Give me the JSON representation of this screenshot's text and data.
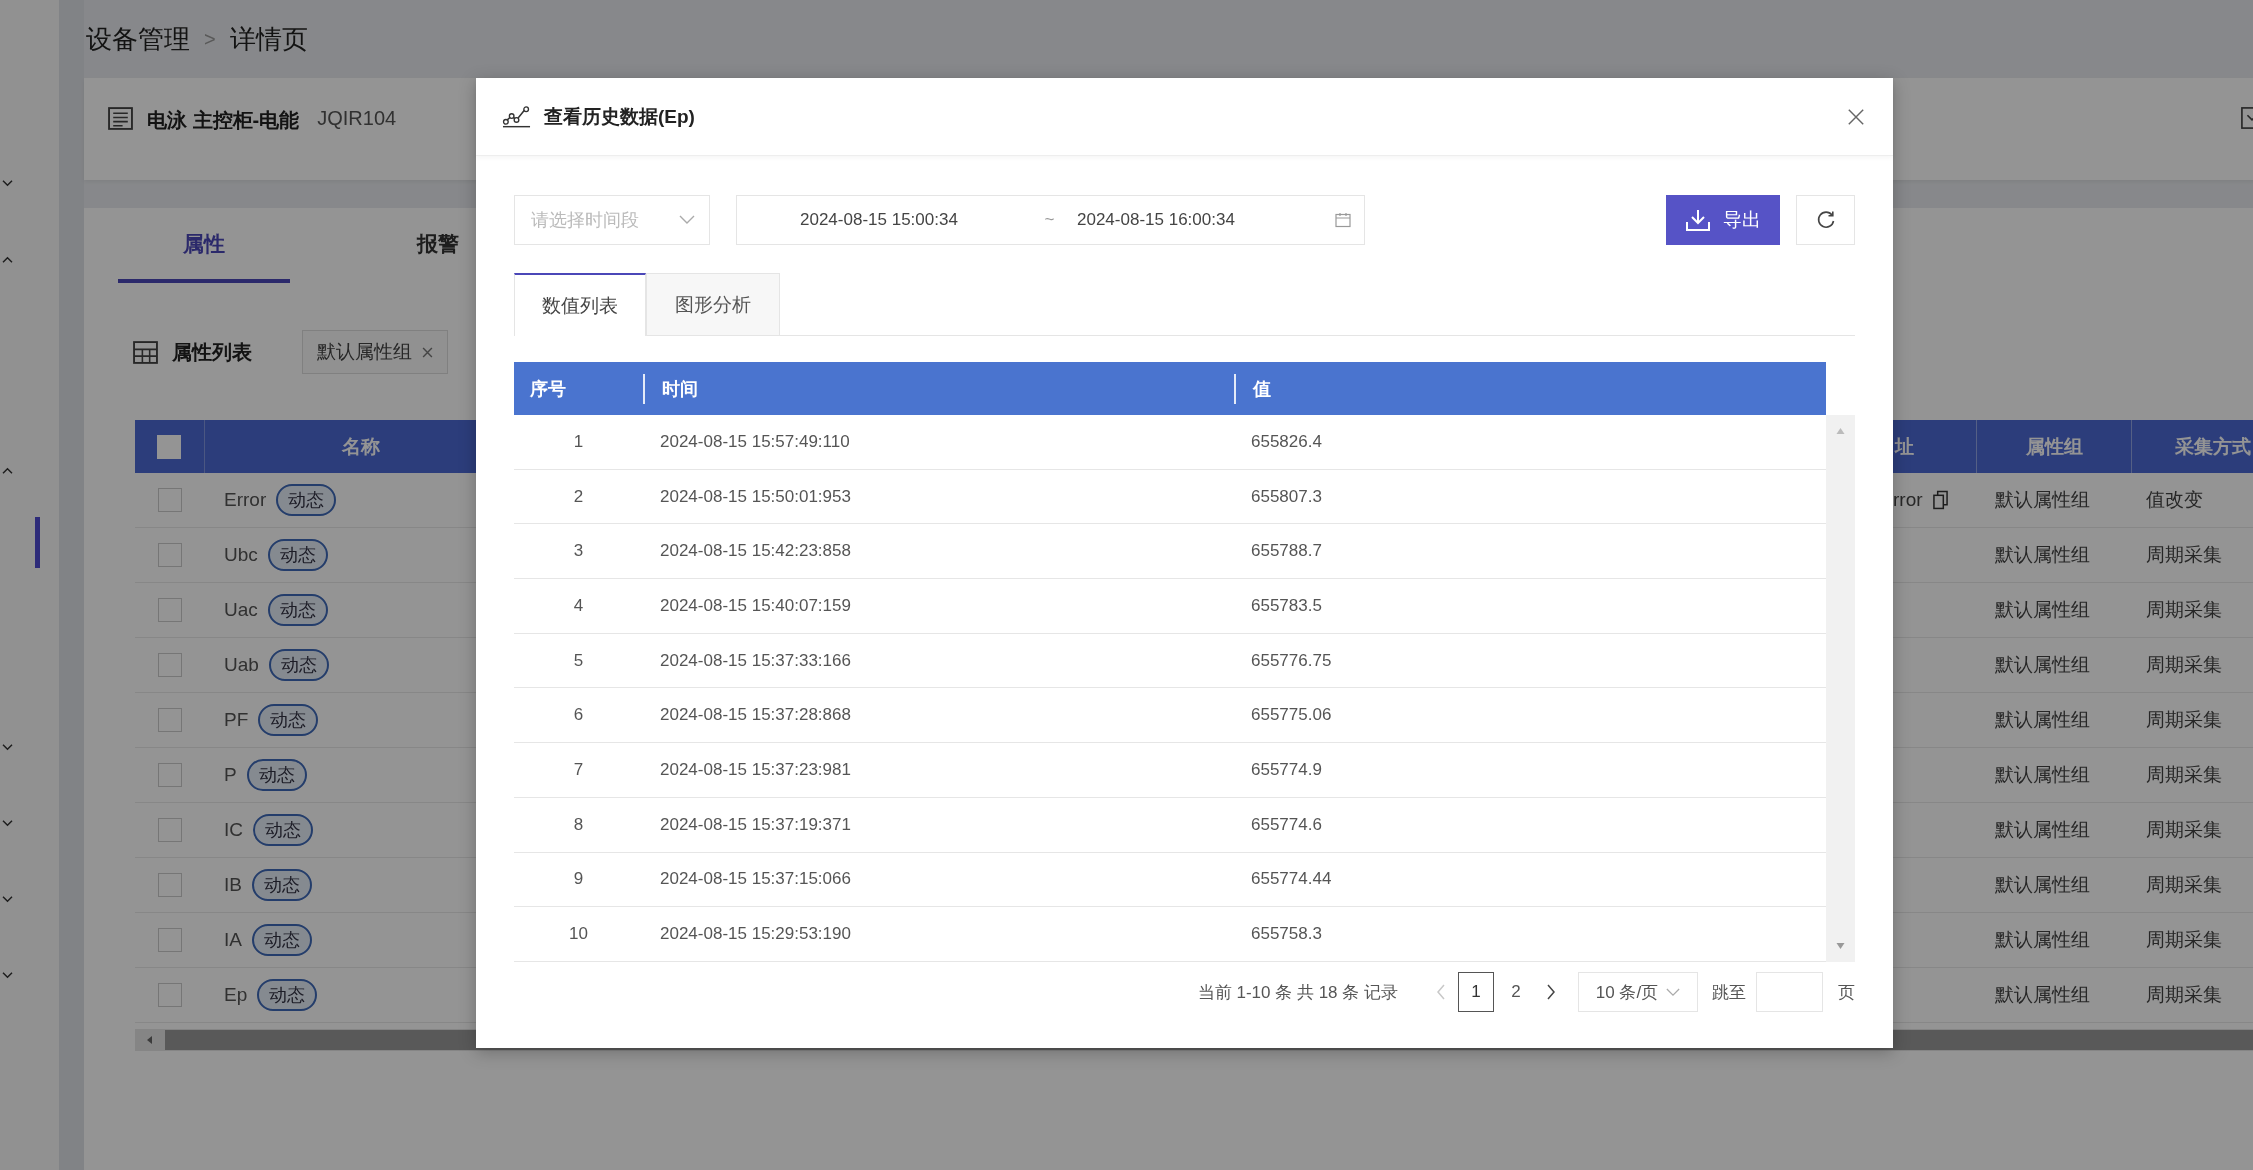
{
  "breadcrumb": {
    "items": [
      "设备管理",
      "详情页"
    ],
    "separator": ">"
  },
  "sidebar": {
    "items": [
      {
        "kind": "group",
        "expanded": false
      },
      {
        "kind": "group",
        "expanded": true
      },
      {
        "kind": "group",
        "expanded": true
      },
      {
        "kind": "link",
        "selected": true
      },
      {
        "kind": "group",
        "expanded": false
      },
      {
        "kind": "group",
        "expanded": false
      },
      {
        "kind": "group",
        "expanded": false
      },
      {
        "kind": "group",
        "expanded": false
      }
    ]
  },
  "device": {
    "name": "电泳 主控柜-电能",
    "code": "JQIR104"
  },
  "tabs": [
    {
      "label": "属性",
      "selected": true
    },
    {
      "label": "报警",
      "selected": false
    }
  ],
  "attribute_list": {
    "title": "属性列表",
    "filter_tag": "默认属性组"
  },
  "table": {
    "header_checked": false,
    "columns": {
      "name": "名称",
      "address": "址",
      "group": "属性组",
      "method": "采集方式"
    },
    "rows": [
      {
        "checked": false,
        "name": "Error",
        "tag": "动态",
        "address": "rror",
        "group": "默认属性组",
        "method": "值改变"
      },
      {
        "checked": false,
        "name": "Ubc",
        "tag": "动态",
        "group": "默认属性组",
        "method": "周期采集"
      },
      {
        "checked": false,
        "name": "Uac",
        "tag": "动态",
        "group": "默认属性组",
        "method": "周期采集"
      },
      {
        "checked": false,
        "name": "Uab",
        "tag": "动态",
        "group": "默认属性组",
        "method": "周期采集"
      },
      {
        "checked": false,
        "name": "PF",
        "tag": "动态",
        "group": "默认属性组",
        "method": "周期采集"
      },
      {
        "checked": false,
        "name": "P",
        "tag": "动态",
        "group": "默认属性组",
        "method": "周期采集"
      },
      {
        "checked": false,
        "name": "IC",
        "tag": "动态",
        "group": "默认属性组",
        "method": "周期采集"
      },
      {
        "checked": false,
        "name": "IB",
        "tag": "动态",
        "group": "默认属性组",
        "method": "周期采集"
      },
      {
        "checked": false,
        "name": "IA",
        "tag": "动态",
        "group": "默认属性组",
        "method": "周期采集"
      },
      {
        "checked": false,
        "name": "Ep",
        "tag": "动态",
        "group": "默认属性组",
        "method": "周期采集"
      }
    ]
  },
  "modal": {
    "title": "查看历史数据(Ep)",
    "range_select": {
      "placeholder": "请选择时间段"
    },
    "date_range": {
      "start": "2024-08-15 15:00:34",
      "separator": "~",
      "end": "2024-08-15 16:00:34"
    },
    "export_label": "导出",
    "tabs": [
      {
        "label": "数值列表",
        "selected": true
      },
      {
        "label": "图形分析",
        "selected": false
      }
    ],
    "columns": [
      "序号",
      "时间",
      "值"
    ],
    "rows": [
      {
        "index": "1",
        "time": "2024-08-15 15:57:49:110",
        "value": "655826.4"
      },
      {
        "index": "2",
        "time": "2024-08-15 15:50:01:953",
        "value": "655807.3"
      },
      {
        "index": "3",
        "time": "2024-08-15 15:42:23:858",
        "value": "655788.7"
      },
      {
        "index": "4",
        "time": "2024-08-15 15:40:07:159",
        "value": "655783.5"
      },
      {
        "index": "5",
        "time": "2024-08-15 15:37:33:166",
        "value": "655776.75"
      },
      {
        "index": "6",
        "time": "2024-08-15 15:37:28:868",
        "value": "655775.06"
      },
      {
        "index": "7",
        "time": "2024-08-15 15:37:23:981",
        "value": "655774.9"
      },
      {
        "index": "8",
        "time": "2024-08-15 15:37:19:371",
        "value": "655774.6"
      },
      {
        "index": "9",
        "time": "2024-08-15 15:37:15:066",
        "value": "655774.44"
      },
      {
        "index": "10",
        "time": "2024-08-15 15:29:53:190",
        "value": "655758.3"
      }
    ],
    "pagination": {
      "summary": "当前 1-10 条 共 18 条 记录",
      "prev_disabled": true,
      "pages": [
        {
          "label": "1",
          "selected": true
        },
        {
          "label": "2",
          "selected": false
        }
      ],
      "page_size": "10 条/页",
      "jump_label": "跳至",
      "page_unit": "页"
    }
  }
}
